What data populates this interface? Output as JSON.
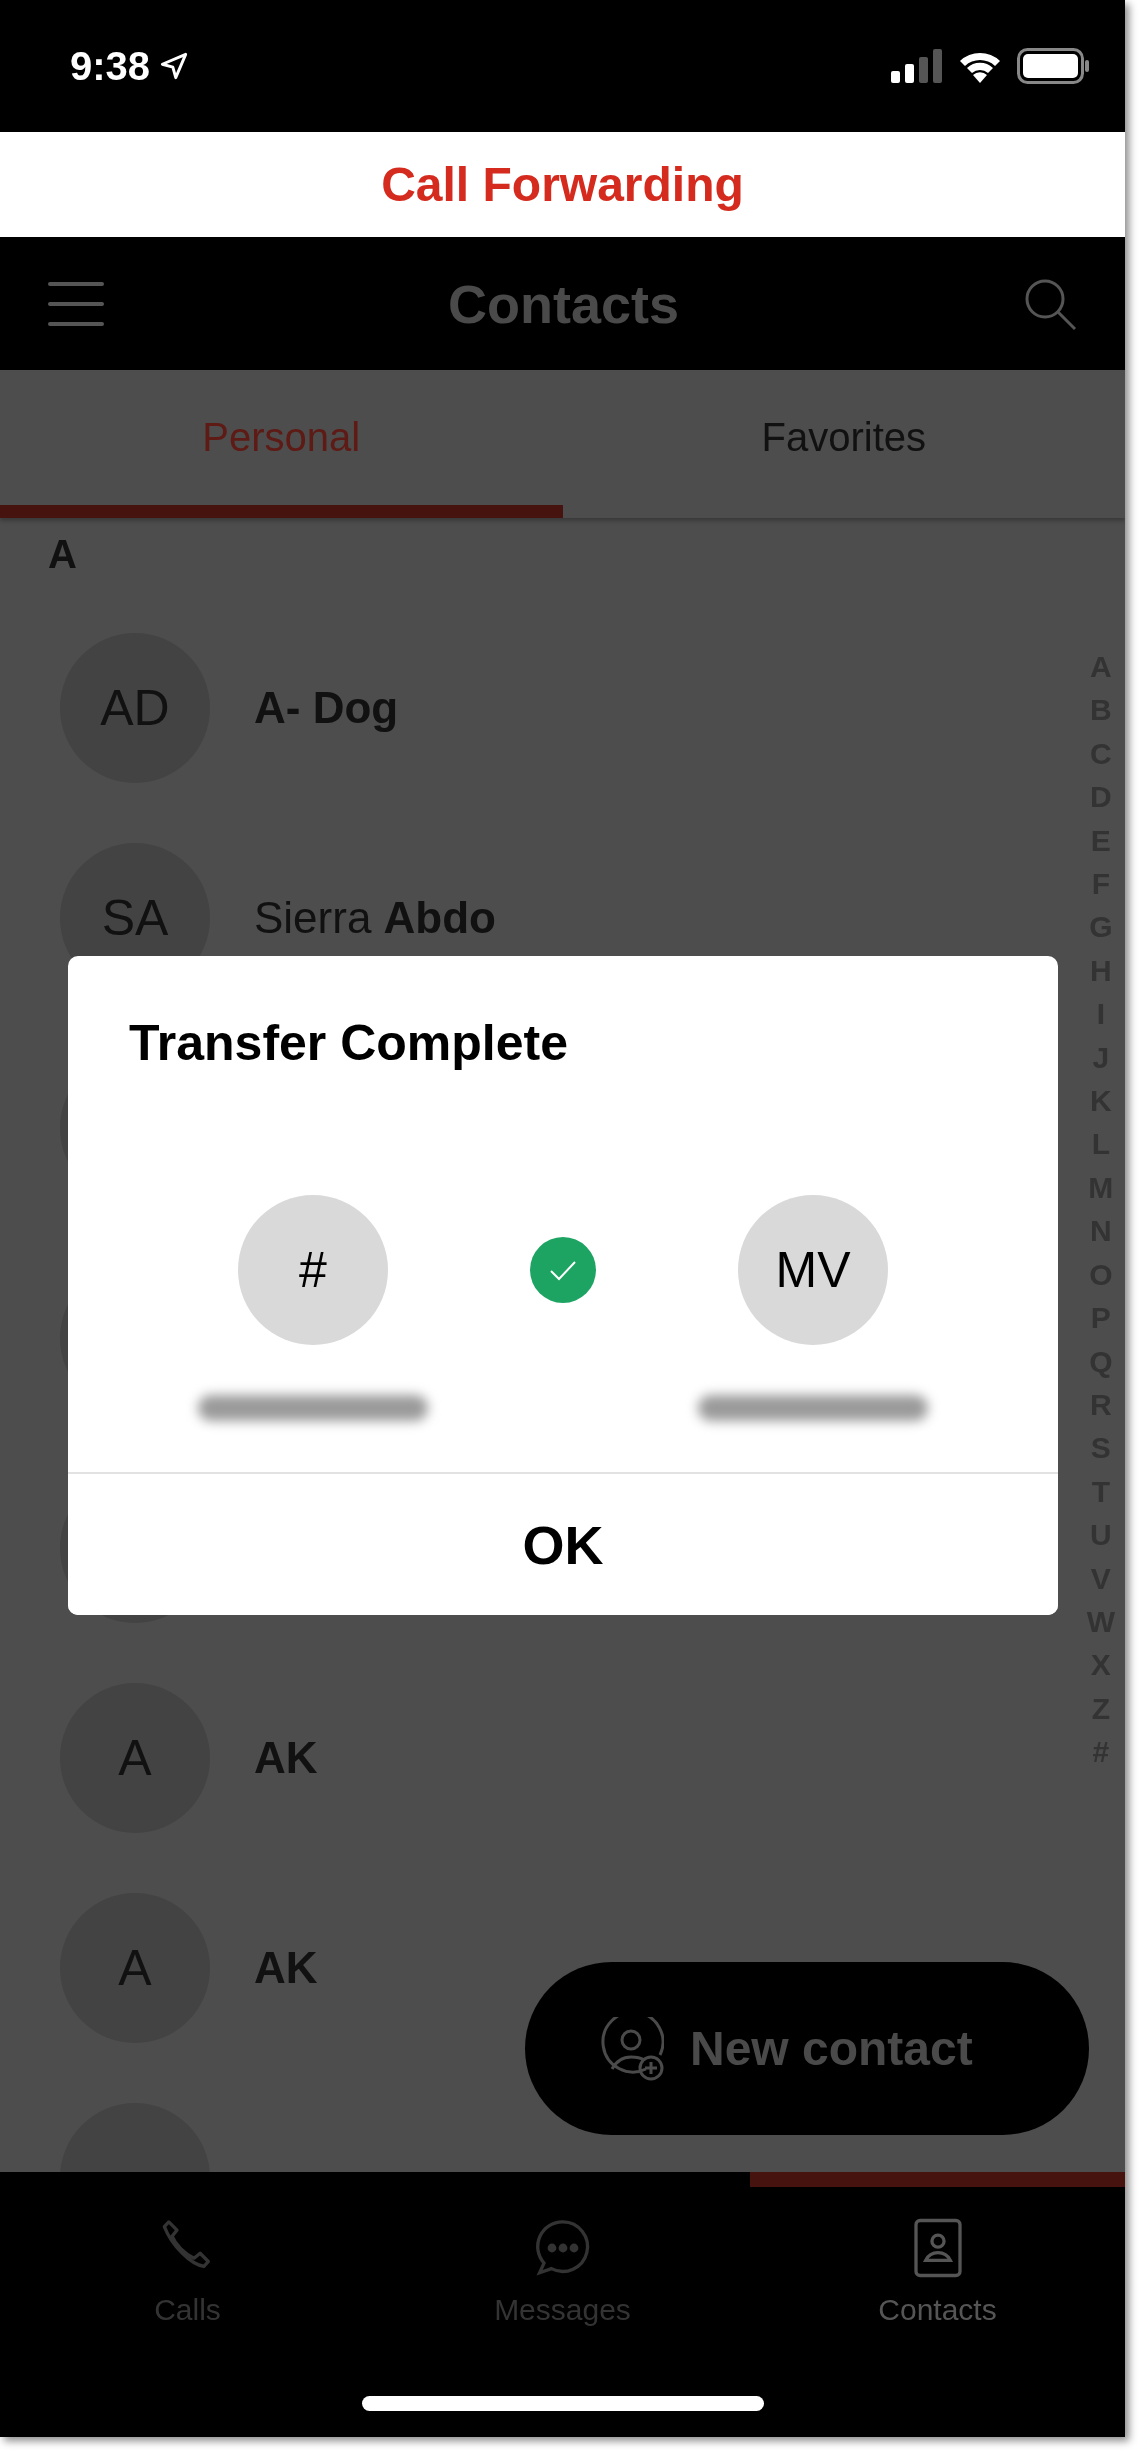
{
  "status_bar": {
    "time": "9:38"
  },
  "banner": {
    "title": "Call Forwarding"
  },
  "header": {
    "title": "Contacts"
  },
  "tabs": [
    {
      "label": "Personal",
      "selected": true
    },
    {
      "label": "Favorites",
      "selected": false
    }
  ],
  "section": {
    "letter": "A"
  },
  "contacts": [
    {
      "kind": "contact",
      "initials": "AD",
      "name": "**A- Dog**"
    },
    {
      "kind": "contact",
      "initials": "SA",
      "name": "Sierra **Abdo**"
    },
    {
      "kind": "covered"
    },
    {
      "kind": "covered"
    },
    {
      "kind": "covered"
    },
    {
      "kind": "contact",
      "initials": "A",
      "name": "**AK**"
    },
    {
      "kind": "contact",
      "initials": "A",
      "name": "**AK**"
    },
    {
      "kind": "covered"
    }
  ],
  "index": [
    "A",
    "B",
    "C",
    "D",
    "E",
    "F",
    "G",
    "H",
    "I",
    "J",
    "K",
    "L",
    "M",
    "N",
    "O",
    "P",
    "Q",
    "R",
    "S",
    "T",
    "U",
    "V",
    "W",
    "X",
    "Z",
    "#"
  ],
  "fab": {
    "label": "New contact"
  },
  "dialog": {
    "title": "Transfer Complete",
    "from": {
      "initials": "#"
    },
    "to": {
      "initials": "MV"
    },
    "button": "OK"
  },
  "nav": [
    {
      "kind": "calls",
      "label": "Calls",
      "selected": false
    },
    {
      "kind": "messages",
      "label": "Messages",
      "selected": false
    },
    {
      "kind": "contacts",
      "label": "Contacts",
      "selected": true
    }
  ]
}
